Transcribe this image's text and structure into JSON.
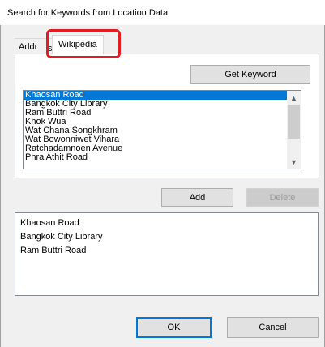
{
  "window": {
    "title": "Search for Keywords from Location Data"
  },
  "tabs": [
    {
      "label": "Addr",
      "label_tail": "s"
    },
    {
      "label": "Wikipedia",
      "selected": true
    }
  ],
  "highlight_color": "#e31b23",
  "get_keyword_label": "Get Keyword",
  "keyword_list": {
    "items": [
      "Khaosan Road",
      "Bangkok City Library",
      "Ram Buttri Road",
      "Khok Wua",
      "Wat Chana Songkhram",
      "Wat Bowonniwet Vihara",
      "Ratchadamnoen Avenue",
      "Phra Athit Road"
    ],
    "selected": "Khaosan Road"
  },
  "add_label": "Add",
  "delete_label": "Delete",
  "selected_list": {
    "items": [
      "Khaosan Road",
      "Bangkok City Library",
      "Ram Buttri Road"
    ]
  },
  "ok_label": "OK",
  "cancel_label": "Cancel"
}
